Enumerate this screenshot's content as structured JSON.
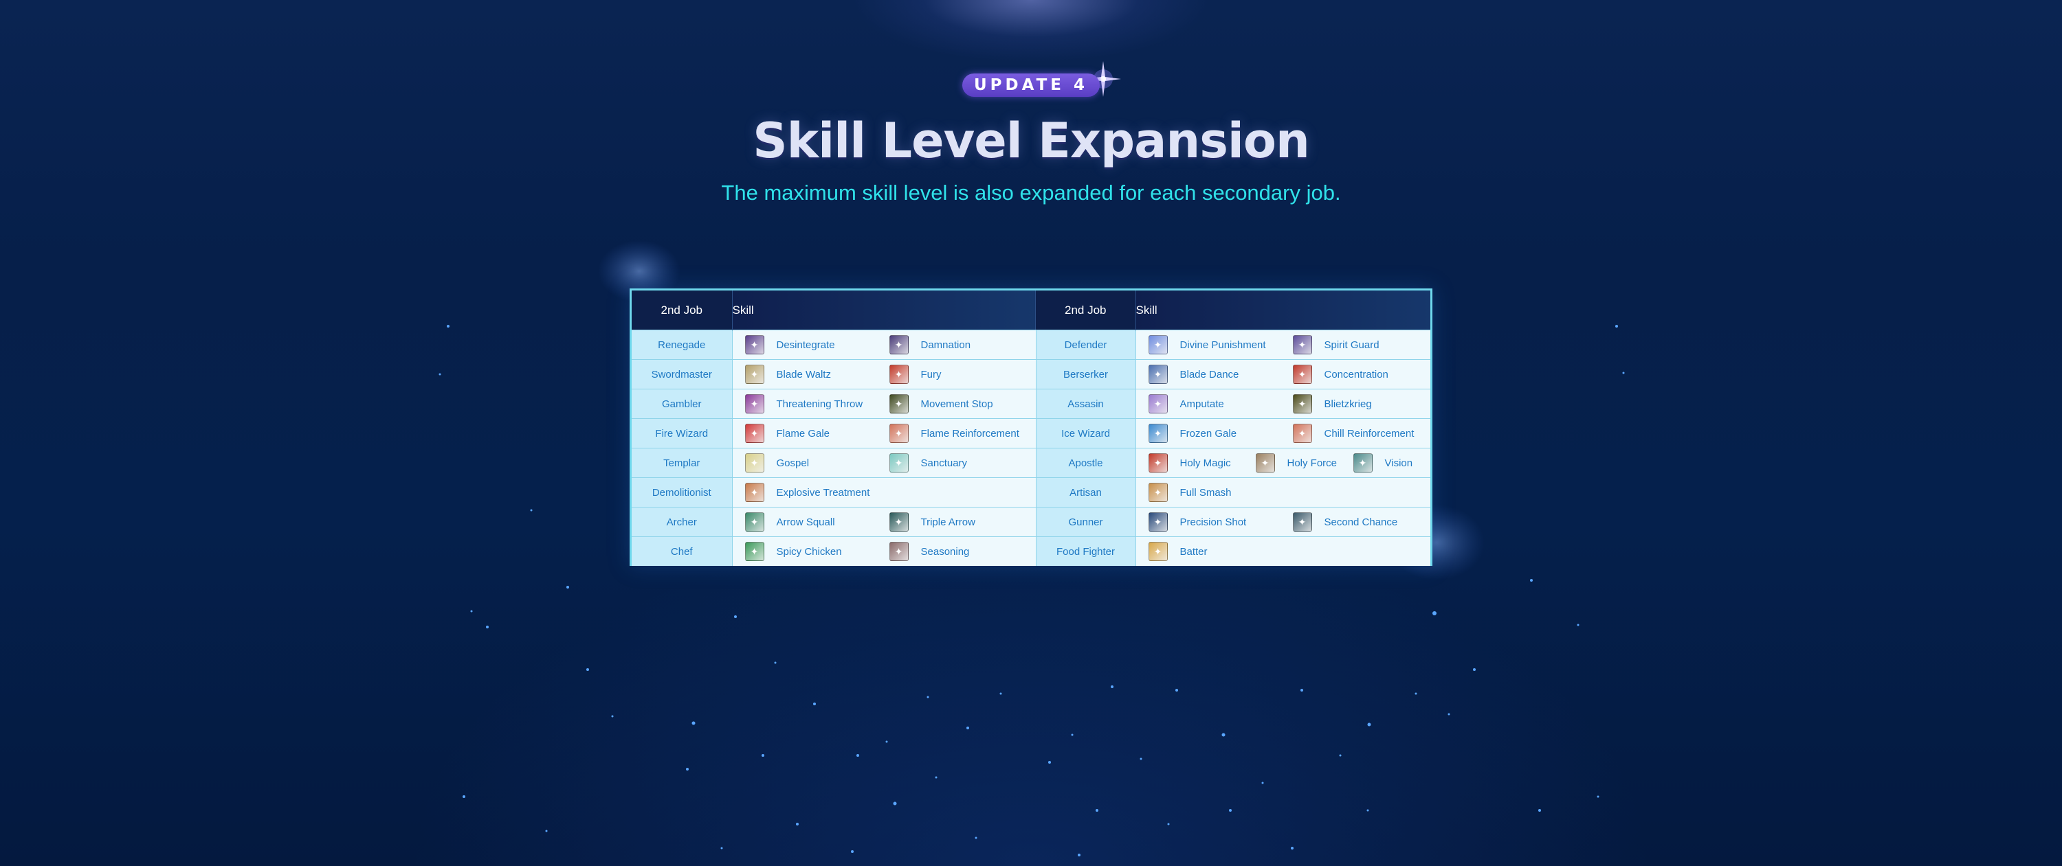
{
  "badge": "UPDATE 4",
  "title": "Skill Level Expansion",
  "subtitle": "The maximum skill level is also expanded for each secondary job.",
  "table": {
    "headers": [
      "2nd Job",
      "Skill",
      "2nd Job",
      "Skill"
    ],
    "rows": [
      {
        "left": {
          "job": "Renegade",
          "skills": [
            {
              "name": "Desintegrate",
              "icon": "desintegrate-icon",
              "color": "#5a3f8c"
            },
            {
              "name": "Damnation",
              "icon": "damnation-icon",
              "color": "#4b3d7a"
            }
          ]
        },
        "right": {
          "job": "Defender",
          "skills": [
            {
              "name": "Divine Punishment",
              "icon": "divine-punishment-icon",
              "color": "#6f8de0"
            },
            {
              "name": "Spirit Guard",
              "icon": "spirit-guard-icon",
              "color": "#5b4c9a"
            }
          ]
        }
      },
      {
        "left": {
          "job": "Swordmaster",
          "skills": [
            {
              "name": "Blade Waltz",
              "icon": "blade-waltz-icon",
              "color": "#b3a06a"
            },
            {
              "name": "Fury",
              "icon": "fury-icon",
              "color": "#c23a2a"
            }
          ]
        },
        "right": {
          "job": "Berserker",
          "skills": [
            {
              "name": "Blade Dance",
              "icon": "blade-dance-icon",
              "color": "#4a6fb0"
            },
            {
              "name": "Concentration",
              "icon": "concentration-icon",
              "color": "#c0392b"
            }
          ]
        }
      },
      {
        "left": {
          "job": "Gambler",
          "skills": [
            {
              "name": "Threatening Throw",
              "icon": "threatening-throw-icon",
              "color": "#8b3a9a"
            },
            {
              "name": "Movement Stop",
              "icon": "movement-stop-icon",
              "color": "#3f4a20"
            }
          ]
        },
        "right": {
          "job": "Assasin",
          "skills": [
            {
              "name": "Amputate",
              "icon": "amputate-icon",
              "color": "#9a7ad0"
            },
            {
              "name": "Blietzkrieg",
              "icon": "blietzkrieg-icon",
              "color": "#4a4a1a"
            }
          ]
        }
      },
      {
        "left": {
          "job": "Fire Wizard",
          "skills": [
            {
              "name": "Flame Gale",
              "icon": "flame-gale-icon",
              "color": "#d23a3a"
            },
            {
              "name": "Flame Reinforcement",
              "icon": "flame-reinforcement-icon",
              "color": "#d2735a"
            }
          ]
        },
        "right": {
          "job": "Ice Wizard",
          "skills": [
            {
              "name": "Frozen Gale",
              "icon": "frozen-gale-icon",
              "color": "#3a8ad0"
            },
            {
              "name": "Chill Reinforcement",
              "icon": "chill-reinforcement-icon",
              "color": "#d2735a"
            }
          ]
        }
      },
      {
        "left": {
          "job": "Templar",
          "skills": [
            {
              "name": "Gospel",
              "icon": "gospel-icon",
              "color": "#d8d08a"
            },
            {
              "name": "Sanctuary",
              "icon": "sanctuary-icon",
              "color": "#7ac8c0"
            }
          ]
        },
        "right": {
          "job": "Apostle",
          "skills": [
            {
              "name": "Holy Magic",
              "icon": "holy-magic-icon",
              "color": "#c23a2a"
            },
            {
              "name": "Holy Force",
              "icon": "holy-force-icon",
              "color": "#9a8060"
            },
            {
              "name": "Vision",
              "icon": "vision-icon",
              "color": "#4a8a8a"
            }
          ]
        }
      },
      {
        "left": {
          "job": "Demolitionist",
          "skills": [
            {
              "name": "Explosive Treatment",
              "icon": "explosive-treatment-icon",
              "color": "#c87a4a"
            }
          ]
        },
        "right": {
          "job": "Artisan",
          "skills": [
            {
              "name": "Full Smash",
              "icon": "full-smash-icon",
              "color": "#c8904a"
            }
          ]
        }
      },
      {
        "left": {
          "job": "Archer",
          "skills": [
            {
              "name": "Arrow Squall",
              "icon": "arrow-squall-icon",
              "color": "#3a8a6a"
            },
            {
              "name": "Triple Arrow",
              "icon": "triple-arrow-icon",
              "color": "#2a5a5a"
            }
          ]
        },
        "right": {
          "job": "Gunner",
          "skills": [
            {
              "name": "Precision Shot",
              "icon": "precision-shot-icon",
              "color": "#2a4a7a"
            },
            {
              "name": "Second Chance",
              "icon": "second-chance-icon",
              "color": "#3a5a6a"
            }
          ]
        }
      },
      {
        "left": {
          "job": "Chef",
          "skills": [
            {
              "name": "Spicy Chicken",
              "icon": "spicy-chicken-icon",
              "color": "#3a9a5a"
            },
            {
              "name": "Seasoning",
              "icon": "seasoning-icon",
              "color": "#8a6a6a"
            }
          ]
        },
        "right": {
          "job": "Food Fighter",
          "skills": [
            {
              "name": "Batter",
              "icon": "batter-icon",
              "color": "#d8a84a"
            }
          ]
        }
      }
    ]
  }
}
